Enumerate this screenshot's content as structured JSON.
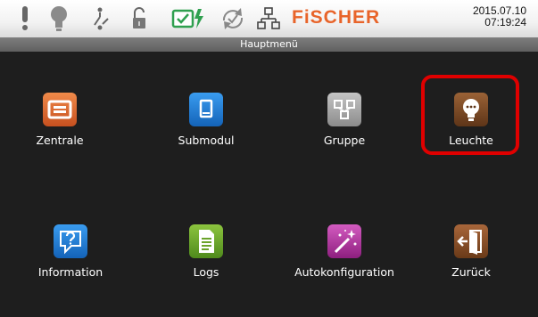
{
  "header": {
    "brand": "FiSCHER",
    "date": "2015.07.10",
    "time": "07:19:24",
    "title": "Hauptmenü",
    "status_icons": [
      "alert-icon",
      "lamp-icon",
      "switch-icon",
      "unlocked-padlock-icon",
      "battery-charging-icon",
      "sync-check-icon",
      "network-icon"
    ]
  },
  "menu": {
    "items": [
      {
        "label": "Zentrale",
        "icon": "central-unit-icon",
        "color": "#d9622f"
      },
      {
        "label": "Submodul",
        "icon": "submodule-icon",
        "color": "#1f7fd6"
      },
      {
        "label": "Gruppe",
        "icon": "group-icon",
        "color": "#a9a9a9"
      },
      {
        "label": "Leuchte",
        "icon": "light-bulb-icon",
        "color": "#7a4a26"
      },
      {
        "label": "Information",
        "icon": "question-mark-icon",
        "color": "#1f7fd6"
      },
      {
        "label": "Logs",
        "icon": "document-icon",
        "color": "#6aa32a"
      },
      {
        "label": "Autokonfiguration",
        "icon": "magic-wand-icon",
        "color": "#b12f9e"
      },
      {
        "label": "Zurück",
        "icon": "exit-door-icon",
        "color": "#8a4f2a"
      }
    ],
    "selected": "Leuchte",
    "highlight_color": "#e00000"
  }
}
